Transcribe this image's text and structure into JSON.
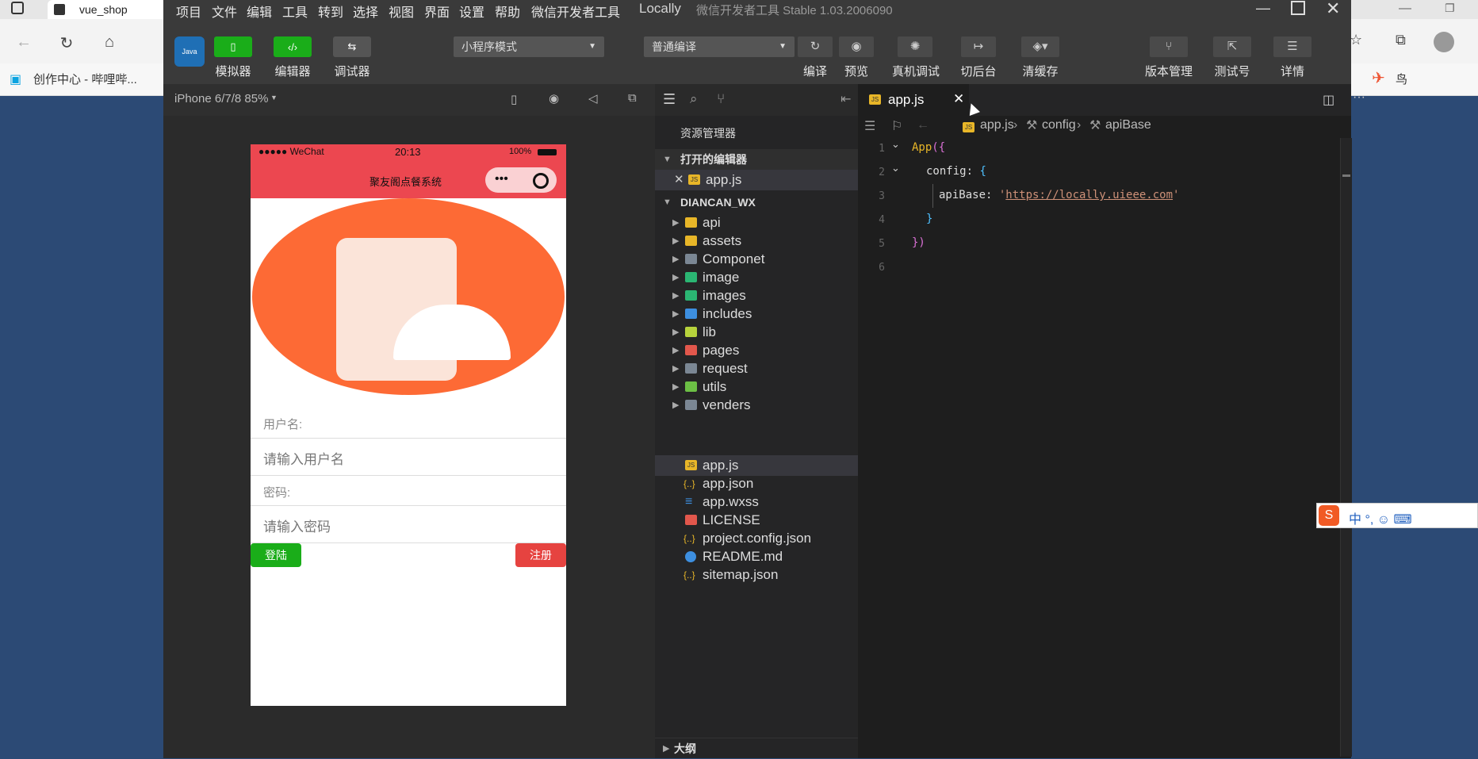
{
  "browser": {
    "tab_title": "vue_shop",
    "bookmark_item": "创作中心 - 哔哩哔...",
    "tray_text": "鸟"
  },
  "ide": {
    "menu": [
      "项目",
      "文件",
      "编辑",
      "工具",
      "转到",
      "选择",
      "视图",
      "界面",
      "设置",
      "帮助",
      "微信开发者工具"
    ],
    "app_name": "Locally",
    "app_version": "微信开发者工具 Stable 1.03.2006090",
    "logo_text": "Java",
    "toolbar": {
      "simulator": "模拟器",
      "editor": "编辑器",
      "debugger": "调试器",
      "mode_select": "小程序模式",
      "compile_select": "普通编译",
      "compile": "编译",
      "preview": "预览",
      "remote_debug": "真机调试",
      "background": "切后台",
      "clear_cache": "清缓存",
      "version_mgmt": "版本管理",
      "test_account": "测试号",
      "details": "详情"
    }
  },
  "simulator": {
    "device": "iPhone 6/7/8 85%",
    "status_left": "●●●●● WeChat",
    "status_time": "20:13",
    "status_battery": "100%",
    "page_title": "聚友阁点餐系统",
    "username_label": "用户名:",
    "username_placeholder": "请输入用户名",
    "password_label": "密码:",
    "password_placeholder": "请输入密码",
    "login_button": "登陆",
    "register_button": "注册"
  },
  "explorer": {
    "title": "资源管理器",
    "open_editors": "打开的编辑器",
    "open_file": "app.js",
    "project": "DIANCAN_WX",
    "folders": [
      {
        "name": "api",
        "color": "#e8b628"
      },
      {
        "name": "assets",
        "color": "#e8b628"
      },
      {
        "name": "Componet",
        "color": "#7b8794"
      },
      {
        "name": "image",
        "color": "#2bb673"
      },
      {
        "name": "images",
        "color": "#2bb673"
      },
      {
        "name": "includes",
        "color": "#3d8fe0"
      },
      {
        "name": "lib",
        "color": "#b7d33c"
      },
      {
        "name": "pages",
        "color": "#e2574c"
      },
      {
        "name": "request",
        "color": "#7b8794"
      },
      {
        "name": "utils",
        "color": "#6cbf45"
      },
      {
        "name": "venders",
        "color": "#7b8794"
      }
    ],
    "files": [
      {
        "name": "app.js",
        "icon": "JS",
        "color": "#e8b628"
      },
      {
        "name": "app.json",
        "icon": "{..}",
        "color": "#e8b628"
      },
      {
        "name": "app.wxss",
        "icon": "≡",
        "color": "#3d8fe0"
      },
      {
        "name": "LICENSE",
        "icon": "☷",
        "color": "#e2574c"
      },
      {
        "name": "project.config.json",
        "icon": "{..}",
        "color": "#e8b628"
      },
      {
        "name": "README.md",
        "icon": "i",
        "color": "#3d8fe0"
      },
      {
        "name": "sitemap.json",
        "icon": "{..}",
        "color": "#e8b628"
      }
    ],
    "outline": "大纲"
  },
  "editor": {
    "tab": "app.js",
    "breadcrumb": [
      "app.js",
      "config",
      "apiBase"
    ],
    "lines": [
      "1",
      "2",
      "3",
      "4",
      "5",
      "6"
    ],
    "code": {
      "l1_fn": "App",
      "l1_paren": "({",
      "l2_key": "config: ",
      "l2_brace": "{",
      "l3_key": "apiBase: ",
      "l3_q1": "'",
      "l3_url": "https://locally.uieee.com",
      "l3_q2": "'",
      "l4": "}",
      "l5": "})"
    }
  },
  "ime": {
    "text": "中 °, ☺ ⌨"
  }
}
